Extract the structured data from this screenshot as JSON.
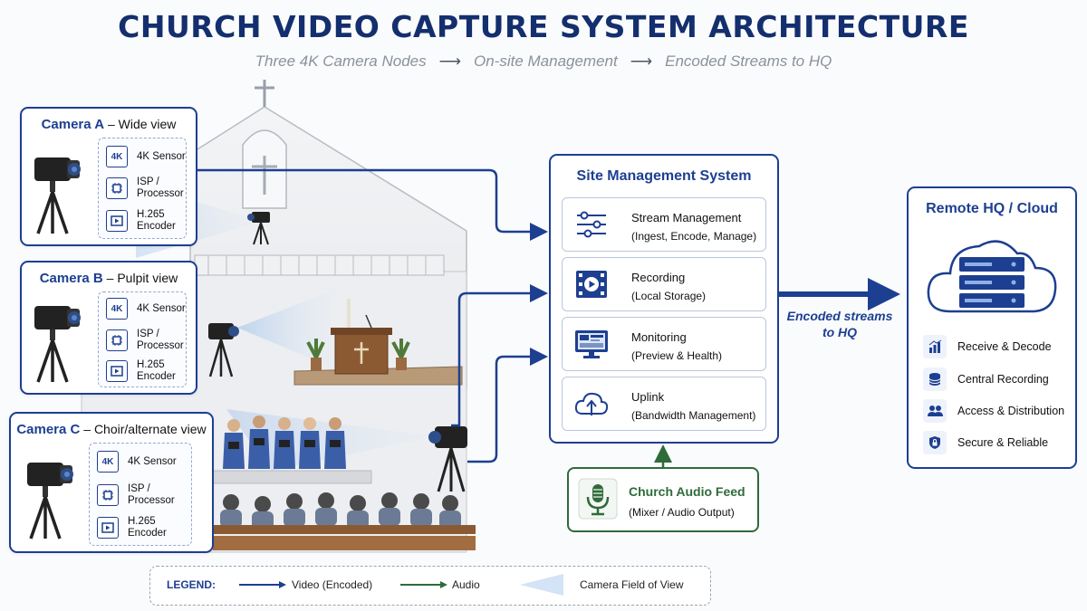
{
  "title": "CHURCH VIDEO CAPTURE SYSTEM ARCHITECTURE",
  "subtitle": {
    "step1": "Three 4K Camera Nodes",
    "step2": "On-site Management",
    "step3": "Encoded Streams to HQ",
    "arrow": "⟶"
  },
  "cameras": [
    {
      "name": "Camera A",
      "sep": "–",
      "view": "Wide view",
      "specs": [
        {
          "icon": "4K",
          "label": "4K Sensor"
        },
        {
          "icon": "chip-icon",
          "label": "ISP / Processor"
        },
        {
          "icon": "play-icon",
          "label": "H.265 Encoder"
        }
      ]
    },
    {
      "name": "Camera B",
      "sep": "–",
      "view": "Pulpit view",
      "specs": [
        {
          "icon": "4K",
          "label": "4K Sensor"
        },
        {
          "icon": "chip-icon",
          "label": "ISP / Processor"
        },
        {
          "icon": "play-icon",
          "label": "H.265 Encoder"
        }
      ]
    },
    {
      "name": "Camera C",
      "sep": "–",
      "view": "Choir/alternate view",
      "specs": [
        {
          "icon": "4K",
          "label": "4K Sensor"
        },
        {
          "icon": "chip-icon",
          "label": "ISP / Processor"
        },
        {
          "icon": "play-icon",
          "label": "H.265 Encoder"
        }
      ]
    }
  ],
  "site_management": {
    "title": "Site Management System",
    "modules": [
      {
        "icon": "sliders-icon",
        "title": "Stream Management",
        "sub": "(Ingest, Encode, Manage)"
      },
      {
        "icon": "film-icon",
        "title": "Recording",
        "sub": "(Local Storage)"
      },
      {
        "icon": "monitor-icon",
        "title": "Monitoring",
        "sub": "(Preview & Health)"
      },
      {
        "icon": "cloud-upload-icon",
        "title": "Uplink",
        "sub": "(Bandwidth Management)"
      }
    ]
  },
  "link_label": "Encoded streams to HQ",
  "hq": {
    "title": "Remote HQ / Cloud",
    "items": [
      {
        "icon": "chart-icon",
        "label": "Receive & Decode"
      },
      {
        "icon": "database-icon",
        "label": "Central Recording"
      },
      {
        "icon": "users-icon",
        "label": "Access & Distribution"
      },
      {
        "icon": "shield-lock-icon",
        "label": "Secure & Reliable"
      }
    ]
  },
  "audio": {
    "title": "Church Audio Feed",
    "sub": "(Mixer / Audio Output)"
  },
  "legend": {
    "title": "LEGEND:",
    "video": "Video (Encoded)",
    "audio": "Audio",
    "fov": "Camera Field of View"
  },
  "colors": {
    "brand_blue": "#1d3f91",
    "title_navy": "#142f6e",
    "audio_green": "#2f6b3a",
    "fov_light_blue": "#c9dcf2"
  }
}
